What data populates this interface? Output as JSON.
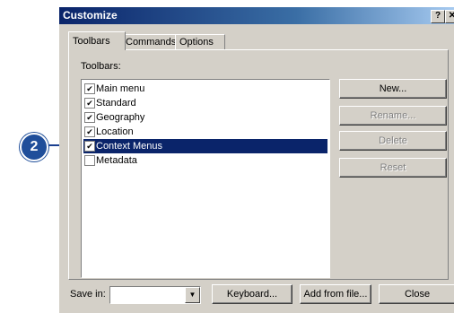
{
  "window": {
    "title": "Customize",
    "help_glyph": "?",
    "close_glyph": "✕"
  },
  "tabs": [
    {
      "label": "Toolbars",
      "active": true
    },
    {
      "label": "Commands",
      "active": false
    },
    {
      "label": "Options",
      "active": false
    }
  ],
  "toolbars_label": "Toolbars:",
  "toolbar_items": [
    {
      "label": "Main menu",
      "checked": true,
      "selected": false
    },
    {
      "label": "Standard",
      "checked": true,
      "selected": false
    },
    {
      "label": "Geography",
      "checked": true,
      "selected": false
    },
    {
      "label": "Location",
      "checked": true,
      "selected": false
    },
    {
      "label": "Context Menus",
      "checked": true,
      "selected": true
    },
    {
      "label": "Metadata",
      "checked": false,
      "selected": false
    }
  ],
  "side_buttons": {
    "new": "New...",
    "rename": "Rename...",
    "delete": "Delete",
    "reset": "Reset"
  },
  "footer": {
    "save_in_label": "Save in:",
    "save_in_value": "",
    "keyboard": "Keyboard...",
    "add_from_file": "Add from file...",
    "close": "Close"
  },
  "callout": {
    "number": "2"
  },
  "colors": {
    "accent": "#0a246a",
    "callout": "#1f4e9a"
  }
}
